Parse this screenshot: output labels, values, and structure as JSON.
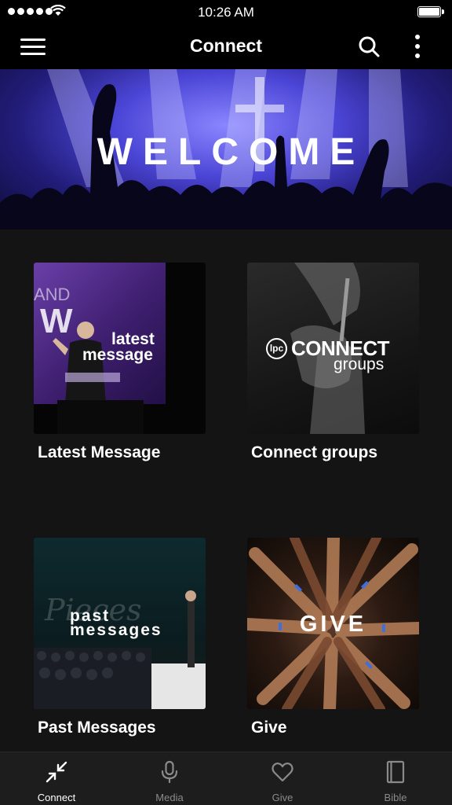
{
  "status_bar": {
    "time": "10:26 AM",
    "signal_icon": "signal-dots-icon",
    "wifi_icon": "wifi-icon",
    "battery_icon": "battery-icon",
    "battery_level": 1.0
  },
  "nav": {
    "title": "Connect",
    "menu_icon": "hamburger-menu-icon",
    "search_icon": "search-icon",
    "more_icon": "more-vertical-icon"
  },
  "banner": {
    "title": "WELCOME"
  },
  "tiles": [
    {
      "label": "Latest Message",
      "thumb_text_1": "latest",
      "thumb_text_2": "message",
      "thumb_bg_text_1": "AND",
      "thumb_bg_text_2": "W"
    },
    {
      "label": "Connect groups",
      "thumb_logo_text": "lpc",
      "thumb_text_1": "CONNECT",
      "thumb_text_2": "groups"
    },
    {
      "label": "Past Messages",
      "thumb_text_1": "past",
      "thumb_text_2": "messages",
      "thumb_bg_text": "Pieces"
    },
    {
      "label": "Give",
      "thumb_text_1": "GIVE"
    }
  ],
  "tab_bar": {
    "items": [
      {
        "label": "Connect",
        "icon": "connect-arrows-icon",
        "active": true
      },
      {
        "label": "Media",
        "icon": "microphone-icon",
        "active": false
      },
      {
        "label": "Give",
        "icon": "heart-icon",
        "active": false
      },
      {
        "label": "Bible",
        "icon": "book-icon",
        "active": false
      }
    ]
  },
  "colors": {
    "background": "#141414",
    "bars": "#000000",
    "tab_bar": "#1d1d1d",
    "tab_inactive": "#8a8a8a",
    "text": "#ffffff"
  }
}
